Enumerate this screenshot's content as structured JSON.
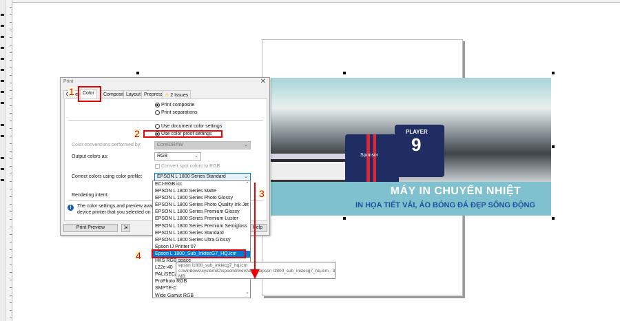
{
  "dialog": {
    "title": "Print",
    "tabs": [
      {
        "label": "General"
      },
      {
        "label": "Color"
      },
      {
        "label": "Composite"
      },
      {
        "label": "Layout"
      },
      {
        "label": "Prepress"
      },
      {
        "label": "2 Issues",
        "icon": "warning-icon"
      }
    ],
    "print_composite": "Print composite",
    "print_separations": "Print separations",
    "use_document_settings": "Use document color settings",
    "use_proof_settings": "Use color proof settings",
    "conversions_label": "Color conversions performed by:",
    "conversions_value": "CorelDRAW",
    "output_label": "Output colors as:",
    "output_value": "RGB",
    "convert_spot": "Convert spot colors to RGB",
    "profile_label": "Correct colors using color profile:",
    "profile_value": "EPSON L 1800 Series Standard",
    "rendering_label": "Rendering intent:",
    "info_line1": "The color settings and preview available d",
    "info_line2": "device printer that you selected on the G",
    "print_preview": "Print Preview",
    "help": "Help"
  },
  "profile_list": [
    "ECI-RGB.icc",
    "EPSON L 1800 Series Matte",
    "EPSON L 1800 Series Photo Glossy",
    "EPSON L 1800 Series Photo Quality Ink Jet",
    "EPSON L 1800 Series Premium Glossy",
    "EPSON L 1800 Series Premium Luster",
    "EPSON L 1800 Series Premium Semigloss",
    "EPSON L 1800 Series Standard",
    "EPSON L 1800 Series Ultra Glossy",
    "Epson IJ Printer 07",
    "Epson L 1800_Sub_InktecG7_HQ.icm",
    "HKS RGB space",
    "L22e-40",
    "PAL/SECAM",
    "ProPhoto RGB",
    "SMPTE-C",
    "Wide Gamut RGB"
  ],
  "selected_index": 10,
  "tooltip": {
    "line1": "epson l1800_sub_inktecg7_hq.icm",
    "line2": "c:\\windows\\system32\\spool\\drivers\\color\\epson l1800_sub_inktecg7_hq.icm - 3.01",
    "line3": "MB"
  },
  "banner": {
    "title": "MÁY IN CHUYỂN NHIỆT",
    "subtitle": "IN HỌA TIẾT VẢI, ÁO BÓNG ĐÁ ĐẸP SỐNG ĐỘNG",
    "jersey_sponsor": "Sponsor",
    "jersey_name": "PLAYER",
    "jersey_number": "9"
  },
  "annotations": {
    "n1": "1",
    "n2": "2",
    "n3": "3",
    "n4": "4"
  },
  "colors": {
    "accent": "#0078d7",
    "annotation": "#ee0000",
    "banner_strip": "#7fc1cf"
  }
}
